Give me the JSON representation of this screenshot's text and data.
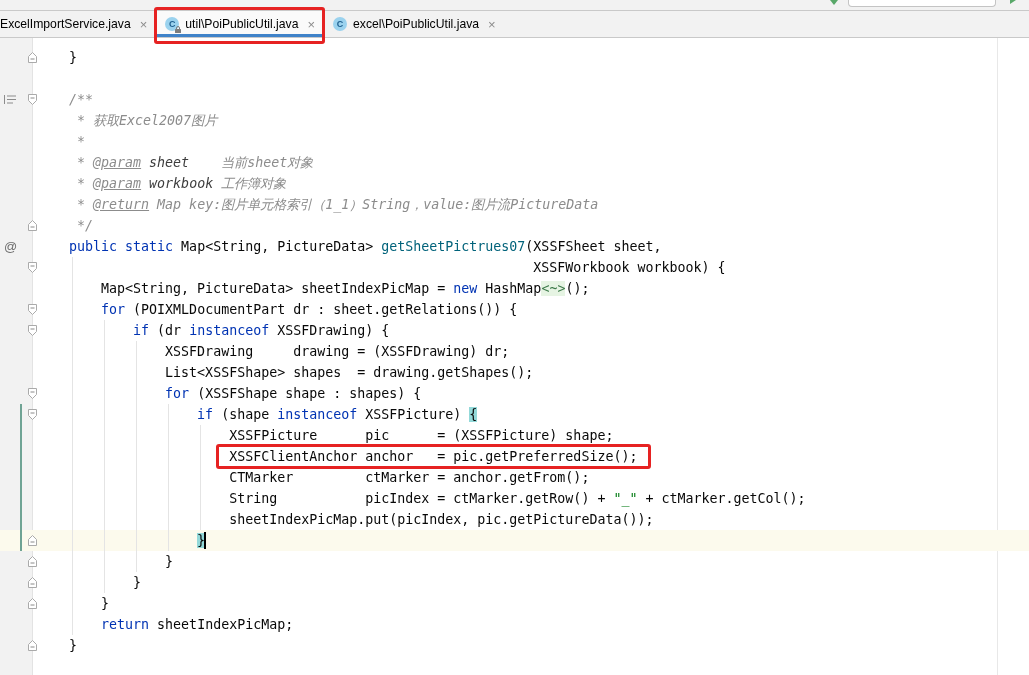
{
  "tabs": [
    {
      "label": "ExcelImportService.java",
      "close": "×",
      "selected": false,
      "annotated": false
    },
    {
      "icon": "C",
      "locked": true,
      "label": "util\\PoiPublicUtil.java",
      "close": "×",
      "selected": true,
      "annotated": true
    },
    {
      "icon": "C",
      "locked": false,
      "label": "excel\\PoiPublicUtil.java",
      "close": "×",
      "selected": false,
      "annotated": false
    }
  ],
  "editor": {
    "lines": [
      {
        "kind": "code",
        "tokens": [
          {
            "kind": "plain",
            "text": "    }"
          }
        ],
        "fold": {
          "kind": "end"
        },
        "changed": false,
        "current": false,
        "annotated": false
      },
      {
        "kind": "blank",
        "changed": false,
        "current": false,
        "annotated": false
      },
      {
        "kind": "code",
        "tokens": [
          {
            "kind": "comment",
            "text": "    /**"
          }
        ],
        "fold": {
          "kind": "start"
        },
        "gutter_icon": {
          "kind": "render-doc"
        },
        "changed": false,
        "current": false,
        "annotated": false
      },
      {
        "kind": "code",
        "tokens": [
          {
            "kind": "comment",
            "text": "     * 获取Excel2007图片"
          }
        ],
        "changed": false,
        "current": false,
        "annotated": false
      },
      {
        "kind": "code",
        "tokens": [
          {
            "kind": "comment",
            "text": "     *"
          }
        ],
        "changed": false,
        "current": false,
        "annotated": false
      },
      {
        "kind": "code",
        "tokens": [
          {
            "kind": "comment",
            "text": "     * "
          },
          {
            "kind": "doc-tag",
            "text": "@param"
          },
          {
            "kind": "doc-param",
            "text": " sheet"
          },
          {
            "kind": "comment",
            "text": "    当前sheet对象"
          }
        ],
        "changed": false,
        "current": false,
        "annotated": false
      },
      {
        "kind": "code",
        "tokens": [
          {
            "kind": "comment",
            "text": "     * "
          },
          {
            "kind": "doc-tag",
            "text": "@param"
          },
          {
            "kind": "doc-param",
            "text": " workbook"
          },
          {
            "kind": "comment",
            "text": " 工作簿对象"
          }
        ],
        "changed": false,
        "current": false,
        "annotated": false
      },
      {
        "kind": "code",
        "tokens": [
          {
            "kind": "comment",
            "text": "     * "
          },
          {
            "kind": "doc-tag",
            "text": "@return"
          },
          {
            "kind": "comment",
            "text": " Map key:图片单元格索引（1_1）String，value:图片流PictureData"
          }
        ],
        "changed": false,
        "current": false,
        "annotated": false
      },
      {
        "kind": "code",
        "tokens": [
          {
            "kind": "comment",
            "text": "     */"
          }
        ],
        "fold": {
          "kind": "end"
        },
        "changed": false,
        "current": false,
        "annotated": false
      },
      {
        "kind": "code",
        "tokens": [
          {
            "kind": "keyword",
            "text": "    public static"
          },
          {
            "kind": "plain",
            "text": " Map<String, PictureData> "
          },
          {
            "kind": "method-decl",
            "text": "getSheetPictrues07"
          },
          {
            "kind": "plain",
            "text": "(XSSFSheet sheet,"
          }
        ],
        "gutter_mark": "@",
        "changed": false,
        "current": false,
        "annotated": false
      },
      {
        "kind": "code",
        "tokens": [
          {
            "kind": "plain",
            "text": "                                                              XSSFWorkbook workbook) {"
          }
        ],
        "fold": {
          "kind": "start"
        },
        "changed": false,
        "current": false,
        "annotated": false
      },
      {
        "kind": "code",
        "tokens": [
          {
            "kind": "plain",
            "text": "        Map<String, PictureData> sheetIndexPicMap = "
          },
          {
            "kind": "keyword",
            "text": "new"
          },
          {
            "kind": "plain",
            "text": " HashMap"
          },
          {
            "kind": "folded",
            "text": "<~>"
          },
          {
            "kind": "plain",
            "text": "();"
          }
        ],
        "changed": false,
        "current": false,
        "annotated": false
      },
      {
        "kind": "code",
        "tokens": [
          {
            "kind": "keyword",
            "text": "        for"
          },
          {
            "kind": "plain",
            "text": " (POIXMLDocumentPart dr : sheet.getRelations()) {"
          }
        ],
        "fold": {
          "kind": "start"
        },
        "changed": false,
        "current": false,
        "annotated": false
      },
      {
        "kind": "code",
        "tokens": [
          {
            "kind": "keyword",
            "text": "            if"
          },
          {
            "kind": "plain",
            "text": " (dr "
          },
          {
            "kind": "keyword",
            "text": "instanceof"
          },
          {
            "kind": "plain",
            "text": " XSSFDrawing) {"
          }
        ],
        "fold": {
          "kind": "start"
        },
        "changed": false,
        "current": false,
        "annotated": false
      },
      {
        "kind": "code",
        "tokens": [
          {
            "kind": "plain",
            "text": "                XSSFDrawing     drawing = (XSSFDrawing) dr;"
          }
        ],
        "changed": false,
        "current": false,
        "annotated": false
      },
      {
        "kind": "code",
        "tokens": [
          {
            "kind": "plain",
            "text": "                List<XSSFShape> shapes  = drawing.getShapes();"
          }
        ],
        "changed": false,
        "current": false,
        "annotated": false
      },
      {
        "kind": "code",
        "tokens": [
          {
            "kind": "keyword",
            "text": "                for"
          },
          {
            "kind": "plain",
            "text": " (XSSFShape shape : shapes) {"
          }
        ],
        "fold": {
          "kind": "start"
        },
        "changed": false,
        "current": false,
        "annotated": false
      },
      {
        "kind": "code",
        "tokens": [
          {
            "kind": "keyword",
            "text": "                    if"
          },
          {
            "kind": "plain",
            "text": " (shape "
          },
          {
            "kind": "keyword",
            "text": "instanceof"
          },
          {
            "kind": "plain",
            "text": " XSSFPicture) "
          },
          {
            "kind": "brace-match",
            "text": "{"
          }
        ],
        "fold": {
          "kind": "start"
        },
        "changed": true,
        "current": false,
        "annotated": false
      },
      {
        "kind": "code",
        "tokens": [
          {
            "kind": "plain",
            "text": "                        XSSFPicture      pic      = (XSSFPicture) shape;"
          }
        ],
        "changed": true,
        "current": false,
        "annotated": false
      },
      {
        "kind": "code",
        "tokens": [
          {
            "kind": "plain",
            "text": "                        XSSFClientAnchor anchor   = pic.getPreferredSize();"
          }
        ],
        "changed": true,
        "current": false,
        "annotated": true
      },
      {
        "kind": "code",
        "tokens": [
          {
            "kind": "plain",
            "text": "                        CTMarker         ctMarker = anchor.getFrom();"
          }
        ],
        "changed": true,
        "current": false,
        "annotated": false
      },
      {
        "kind": "code",
        "tokens": [
          {
            "kind": "plain",
            "text": "                        String           picIndex = ctMarker.getRow() + "
          },
          {
            "kind": "string",
            "text": "\"_\""
          },
          {
            "kind": "plain",
            "text": " + ctMarker.getCol();"
          }
        ],
        "changed": true,
        "current": false,
        "annotated": false
      },
      {
        "kind": "code",
        "tokens": [
          {
            "kind": "plain",
            "text": "                        sheetIndexPicMap.put(picIndex, pic.getPictureData());"
          }
        ],
        "changed": true,
        "current": false,
        "annotated": false
      },
      {
        "kind": "code",
        "tokens": [
          {
            "kind": "brace-match",
            "text": "                    }"
          }
        ],
        "fold": {
          "kind": "end"
        },
        "changed": true,
        "current": true,
        "annotated": false
      },
      {
        "kind": "code",
        "tokens": [
          {
            "kind": "plain",
            "text": "                }"
          }
        ],
        "fold": {
          "kind": "end"
        },
        "changed": false,
        "current": false,
        "annotated": false
      },
      {
        "kind": "code",
        "tokens": [
          {
            "kind": "plain",
            "text": "            }"
          }
        ],
        "fold": {
          "kind": "end"
        },
        "changed": false,
        "current": false,
        "annotated": false
      },
      {
        "kind": "code",
        "tokens": [
          {
            "kind": "plain",
            "text": "        }"
          }
        ],
        "fold": {
          "kind": "end"
        },
        "changed": false,
        "current": false,
        "annotated": false
      },
      {
        "kind": "code",
        "tokens": [
          {
            "kind": "keyword",
            "text": "        return"
          },
          {
            "kind": "plain",
            "text": " sheetIndexPicMap;"
          }
        ],
        "changed": false,
        "current": false,
        "annotated": false
      },
      {
        "kind": "code",
        "tokens": [
          {
            "kind": "plain",
            "text": "    }"
          }
        ],
        "fold": {
          "kind": "end"
        },
        "changed": false,
        "current": false,
        "annotated": false
      }
    ]
  }
}
